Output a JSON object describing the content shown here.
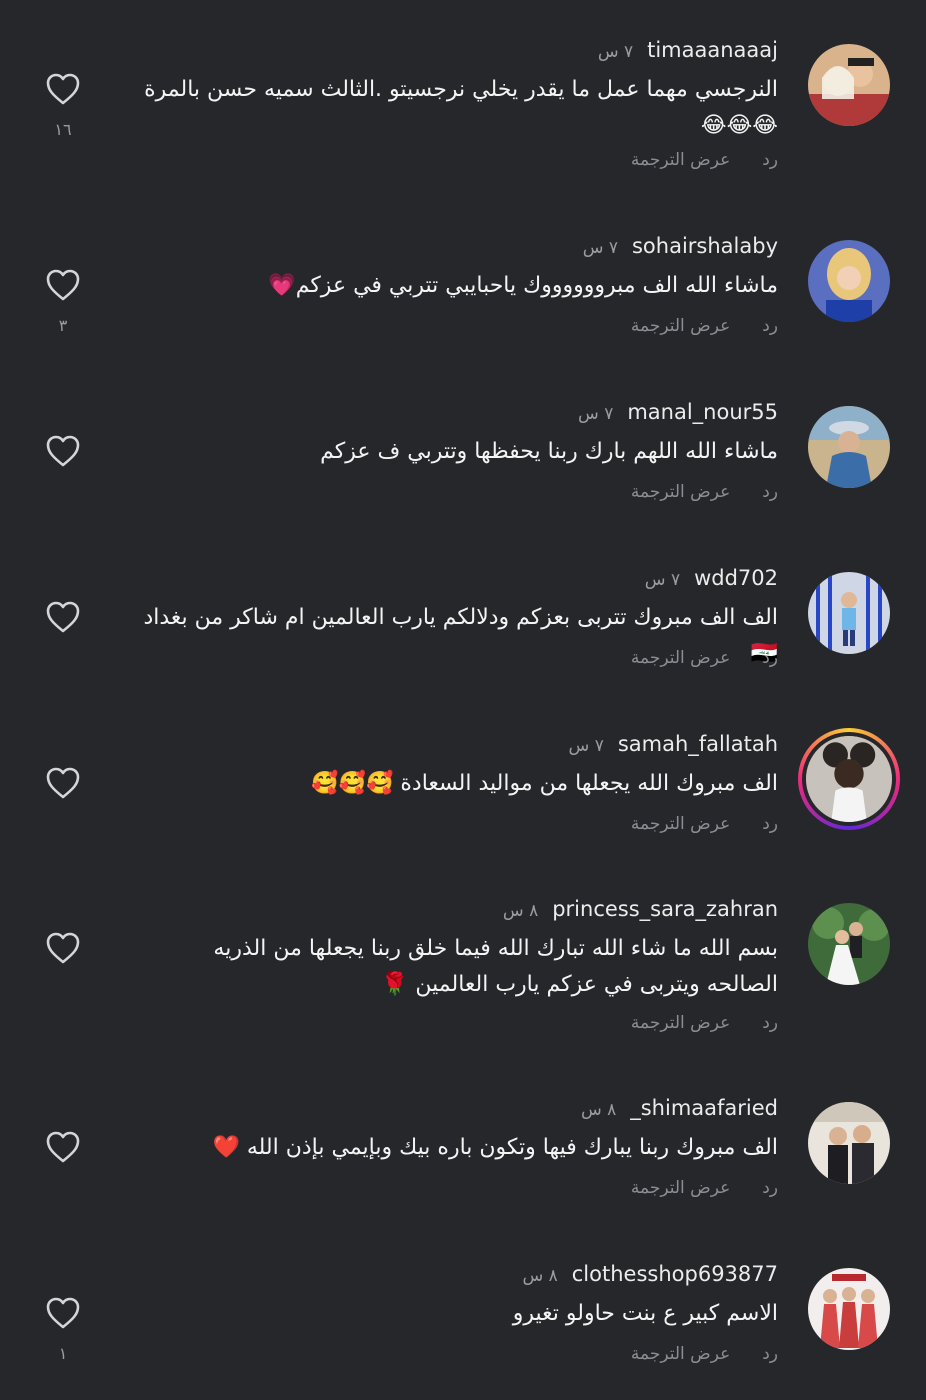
{
  "comments": [
    {
      "username": "timaaanaaaj",
      "time": "٧ س",
      "text": "النرجسي مهما عمل ما يقدر يخلي نرجسيتو .الثالث سميه حسن بالمرة 😂😂😂",
      "reply": "رد",
      "translate": "عرض الترجمة",
      "likes": "١٦"
    },
    {
      "username": "sohairshalaby",
      "time": "٧ س",
      "text": "ماشاء الله  الف مبرووووووك ياحبايبي تتربي في عزكم💗",
      "reply": "رد",
      "translate": "عرض الترجمة",
      "likes": "٣"
    },
    {
      "username": "manal_nour55",
      "time": "٧ س",
      "text": "ماشاء الله اللهم بارك ربنا يحفظها وتتربي ف عزكم",
      "reply": "رد",
      "translate": "عرض الترجمة",
      "likes": ""
    },
    {
      "username": "wdd702",
      "time": "٧ س",
      "text": "الف الف مبروك تتربى بعزكم ودلالكم يارب العالمين ام شاكر من بغداد 🇮🇶",
      "reply": "رد",
      "translate": "عرض الترجمة",
      "likes": ""
    },
    {
      "username": "samah_fallatah",
      "time": "٧ س",
      "text": "الف مبروك الله يجعلها من مواليد السعادة 🥰🥰🥰",
      "reply": "رد",
      "translate": "عرض الترجمة",
      "likes": ""
    },
    {
      "username": "princess_sara_zahran",
      "time": "٨ س",
      "text": "بسم الله ما شاء الله تبارك الله فيما خلق ربنا يجعلها من الذريه الصالحه ويتربى في عزكم يارب العالمين 🌹",
      "reply": "رد",
      "translate": "عرض الترجمة",
      "likes": ""
    },
    {
      "username": "shimaafaried_",
      "time": "٨ س",
      "text": "الف مبروك ربنا يبارك فيها وتكون باره بيك وبإيمي بإذن الله ❤️",
      "reply": "رد",
      "translate": "عرض الترجمة",
      "likes": ""
    },
    {
      "username": "clothesshop693877",
      "time": "٨ س",
      "text": "الاسم كبير ع بنت حاولو تغيرو",
      "reply": "رد",
      "translate": "عرض الترجمة",
      "likes": "١"
    }
  ],
  "icons": {
    "like": "heart-outline-icon"
  },
  "colors": {
    "background": "#26272b",
    "story_ring": "#ee2a7b"
  }
}
